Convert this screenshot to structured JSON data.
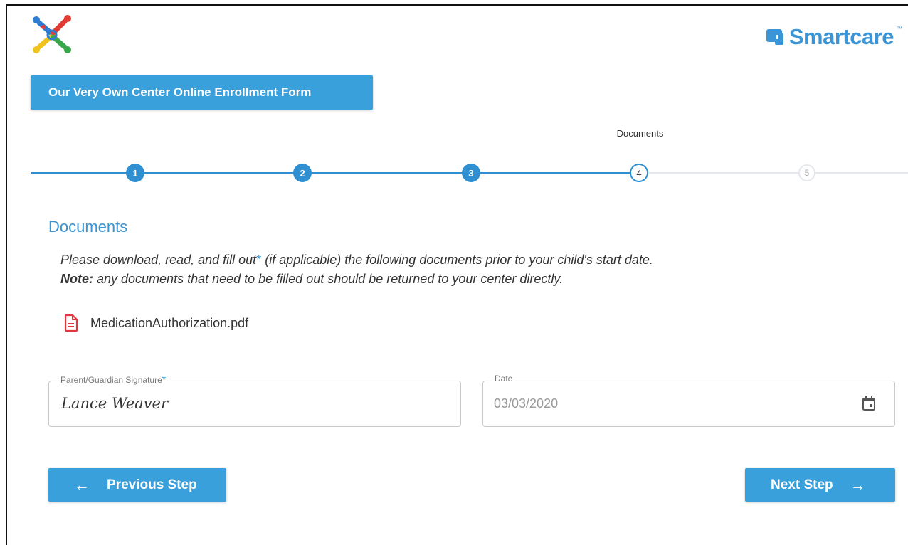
{
  "brand": {
    "name": "Smartcare",
    "tm": "™"
  },
  "form": {
    "title": "Our Very Own Center Online Enrollment Form"
  },
  "stepper": {
    "active_caption": "Documents",
    "steps": [
      "1",
      "2",
      "3",
      "4",
      "5"
    ],
    "current_step": 4
  },
  "section": {
    "title": "Documents",
    "instruction_before": "Please download, read, and fill out",
    "instruction_asterisk": "*",
    "instruction_after": " (if applicable) the following documents prior to your child's start date.",
    "note_label": "Note:",
    "note_text": " any documents that need to be filled out should be returned to your center directly."
  },
  "documents": [
    {
      "name": "MedicationAuthorization.pdf",
      "icon": "pdf-file-icon"
    }
  ],
  "signature_field": {
    "label": "Parent/Guardian Signature",
    "required": "*",
    "value": "Lance Weaver"
  },
  "date_field": {
    "label": "Date",
    "value": "03/03/2020",
    "icon": "calendar-icon"
  },
  "buttons": {
    "previous": "Previous Step",
    "next": "Next Step"
  },
  "colors": {
    "accent": "#3aa0dc",
    "step_done": "#2f8fd1",
    "pdf_icon": "#e0383e",
    "heading": "#3a93d2"
  }
}
